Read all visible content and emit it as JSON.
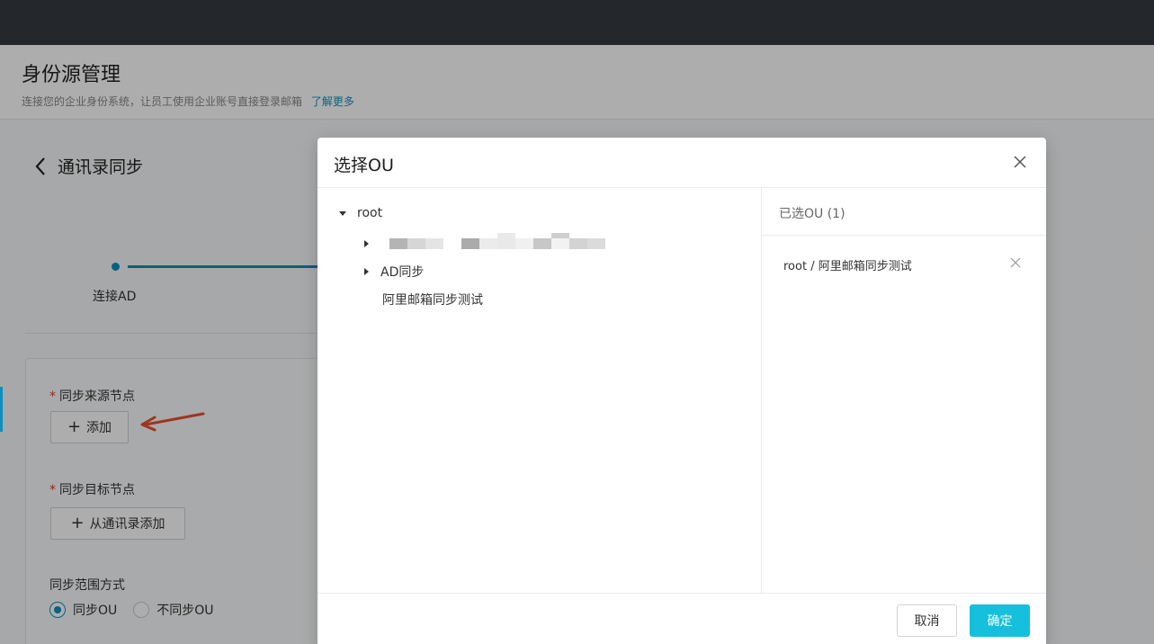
{
  "header": {
    "title": "身份源管理",
    "subtitle": "连接您的企业身份系统，让员工使用企业账号直接登录邮箱",
    "learn_more": "了解更多"
  },
  "page": {
    "back_title": "通讯录同步",
    "step_label": "连接AD"
  },
  "form": {
    "source_label": "同步来源节点",
    "add_button": "添加",
    "target_label": "同步目标节点",
    "add_from_contacts_button": "从通讯录添加",
    "range_label": "同步范围方式",
    "radio_sync_ou": "同步OU",
    "radio_no_sync_ou": "不同步OU",
    "required_mark": "*",
    "plus_glyph": "+"
  },
  "modal": {
    "title": "选择OU",
    "tree": {
      "root": "root",
      "children": [
        {
          "label": "AD同步",
          "expandable": true
        },
        {
          "label": "阿里邮箱同步测试",
          "expandable": false
        }
      ]
    },
    "selected": {
      "title": "已选OU (1)",
      "items": [
        "root / 阿里邮箱同步测试"
      ]
    },
    "cancel": "取消",
    "confirm": "确定"
  },
  "colors": {
    "accent": "#0b8fbe",
    "primary_button": "#14c0dc",
    "required": "#e0332f",
    "annotation_arrow": "#e8502e"
  }
}
